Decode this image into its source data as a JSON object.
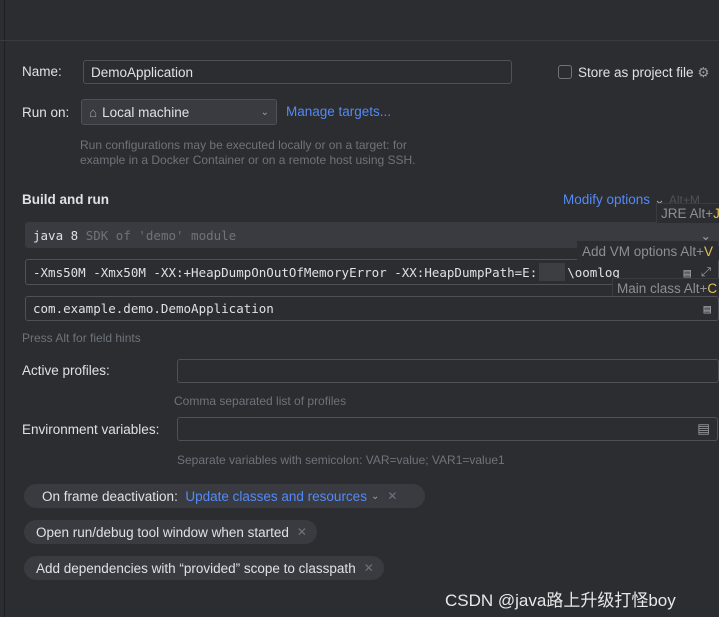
{
  "name": {
    "label": "Name:",
    "value": "DemoApplication"
  },
  "store": {
    "label": "Store as project file"
  },
  "run_on": {
    "label": "Run on:",
    "value": "Local machine",
    "manage": "Manage targets...",
    "hint1": "Run configurations may be executed locally or on a target: for",
    "hint2": "example in a Docker Container or on a remote host using SSH."
  },
  "build": {
    "title": "Build and run",
    "modify": "Modify options",
    "modify_shortcut": "Alt+M",
    "jre_popup": "JRE Alt+",
    "jre_key": "J",
    "sdk": "java 8",
    "sdk_hint": "SDK of 'demo' module",
    "vm_popup": "Add VM options Alt+",
    "vm_key": "V",
    "vm_options": "-Xms50M -Xmx50M -XX:+HeapDumpOnOutOfMemoryError -XX:HeapDumpPath=E:",
    "vm_tail": "\\oomlog",
    "main_popup": "Main class Alt+",
    "main_key": "C",
    "main_class": "com.example.demo.DemoApplication",
    "field_hint": "Press Alt for field hints"
  },
  "profiles": {
    "label": "Active profiles:",
    "hint": "Comma separated list of profiles"
  },
  "env": {
    "label": "Environment variables:",
    "hint": "Separate variables with semicolon: VAR=value; VAR1=value1"
  },
  "chips": {
    "frame_label": "On frame deactivation:",
    "frame_value": "Update classes and resources",
    "open_window": "Open run/debug tool window when started",
    "provided": "Add dependencies with “provided” scope to classpath"
  },
  "watermark": "CSDN @java路上升级打怪boy"
}
